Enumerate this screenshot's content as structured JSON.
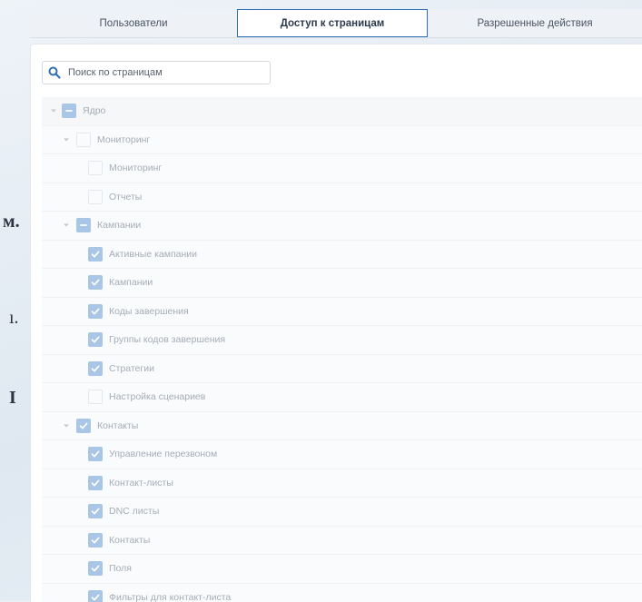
{
  "background_fragments": [
    "м.",
    "ı.",
    "I"
  ],
  "tabs": [
    {
      "label": "Пользователи",
      "active": false
    },
    {
      "label": "Доступ к страницам",
      "active": true
    },
    {
      "label": "Разрешенные действия",
      "active": false
    }
  ],
  "search": {
    "placeholder": "Поиск по страницам",
    "value": ""
  },
  "tree": [
    {
      "label": "Ядро",
      "level": 0,
      "state": "partial",
      "expanded": true
    },
    {
      "label": "Мониторинг",
      "level": 1,
      "state": "unchecked",
      "expanded": true
    },
    {
      "label": "Мониторинг",
      "level": 2,
      "state": "unchecked"
    },
    {
      "label": "Отчеты",
      "level": 2,
      "state": "unchecked"
    },
    {
      "label": "Кампании",
      "level": 1,
      "state": "partial",
      "expanded": true
    },
    {
      "label": "Активные кампании",
      "level": 2,
      "state": "checked"
    },
    {
      "label": "Кампании",
      "level": 2,
      "state": "checked"
    },
    {
      "label": "Коды завершения",
      "level": 2,
      "state": "checked"
    },
    {
      "label": "Группы кодов завершения",
      "level": 2,
      "state": "checked"
    },
    {
      "label": "Стратегии",
      "level": 2,
      "state": "checked"
    },
    {
      "label": "Настройка сценариев",
      "level": 2,
      "state": "unchecked"
    },
    {
      "label": "Контакты",
      "level": 1,
      "state": "checked",
      "expanded": true
    },
    {
      "label": "Управление перезвоном",
      "level": 2,
      "state": "checked"
    },
    {
      "label": "Контакт-листы",
      "level": 2,
      "state": "checked"
    },
    {
      "label": "DNC листы",
      "level": 2,
      "state": "checked"
    },
    {
      "label": "Контакты",
      "level": 2,
      "state": "checked"
    },
    {
      "label": "Поля",
      "level": 2,
      "state": "checked"
    },
    {
      "label": "Фильтры для контакт-листа",
      "level": 2,
      "state": "checked"
    }
  ],
  "colors": {
    "accent": "#2f6fb5",
    "checkbox_fill": "#a9c6e6",
    "label_text": "#a5adb8"
  },
  "icons": {
    "search": "search-icon",
    "expand": "chevron-down-icon",
    "check": "check-icon",
    "partial": "minus-icon"
  }
}
